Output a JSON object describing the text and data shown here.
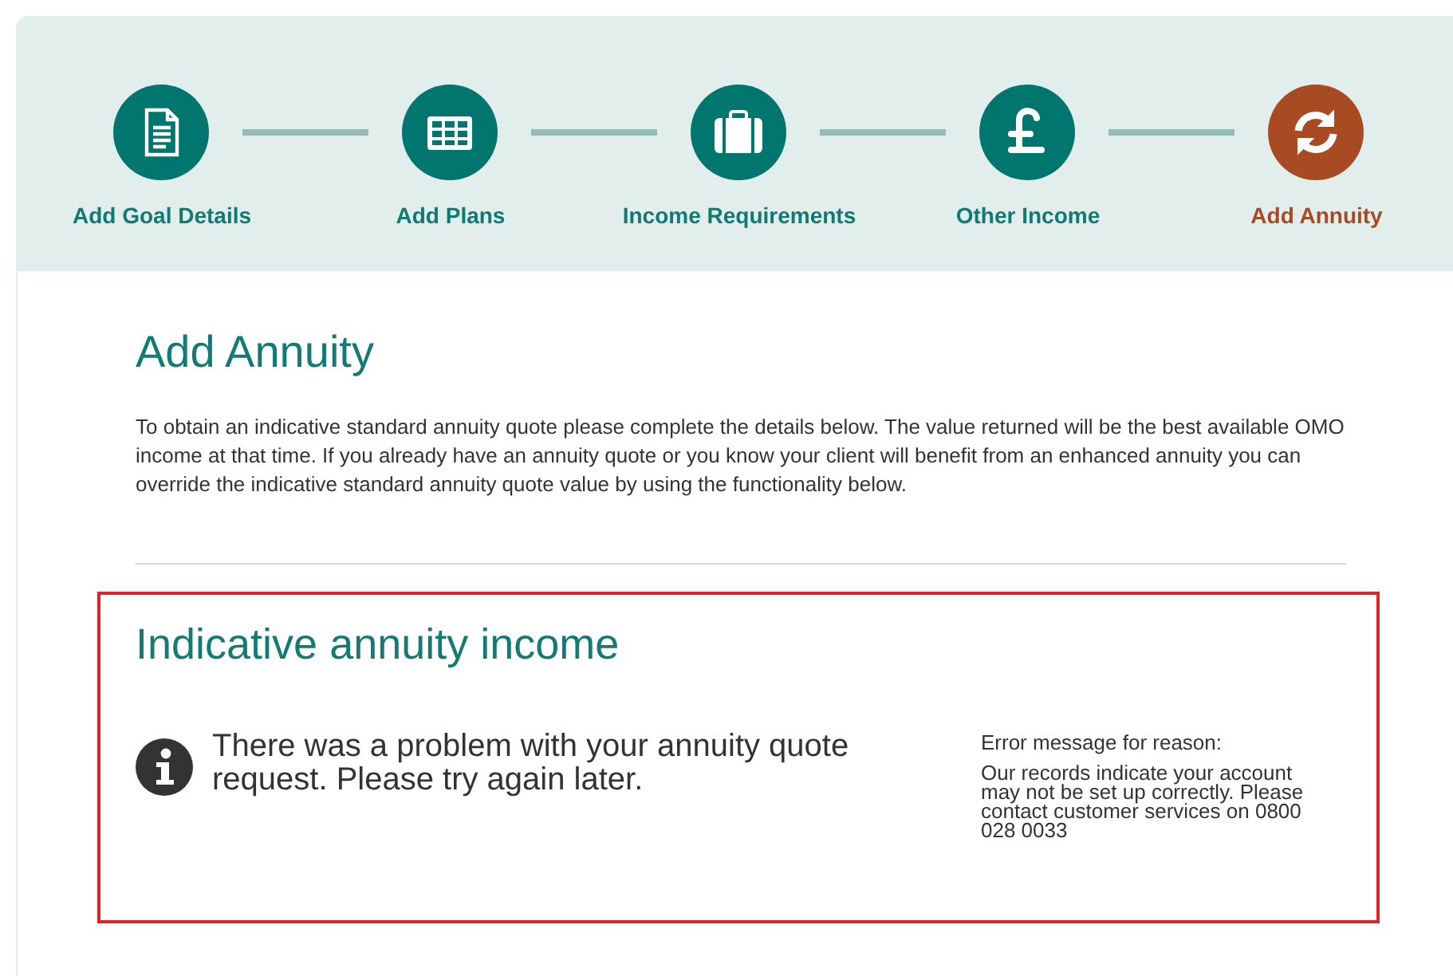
{
  "steps": [
    {
      "label": "Add Goal Details",
      "selected": false
    },
    {
      "label": "Add Plans",
      "selected": false
    },
    {
      "label": "Income Requirements",
      "selected": false
    },
    {
      "label": "Other Income",
      "selected": false
    },
    {
      "label": "Add Annuity",
      "selected": true
    }
  ],
  "page": {
    "title": "Add Annuity",
    "intro": "To obtain an indicative standard annuity quote please complete the details below. The value returned will be the best available OMO income at that time. If you already have an annuity quote or you know your client will benefit from an enhanced annuity you can override the indicative standard annuity quote value by using the functionality below."
  },
  "annuity_panel": {
    "title": "Indicative annuity income",
    "message": "There was a problem with your annuity quote request. Please try again later.",
    "reason_label": "Error message for reason:",
    "reason": "Our records indicate your account may not be set up correctly. Please contact customer services on 0800 028 0033"
  }
}
